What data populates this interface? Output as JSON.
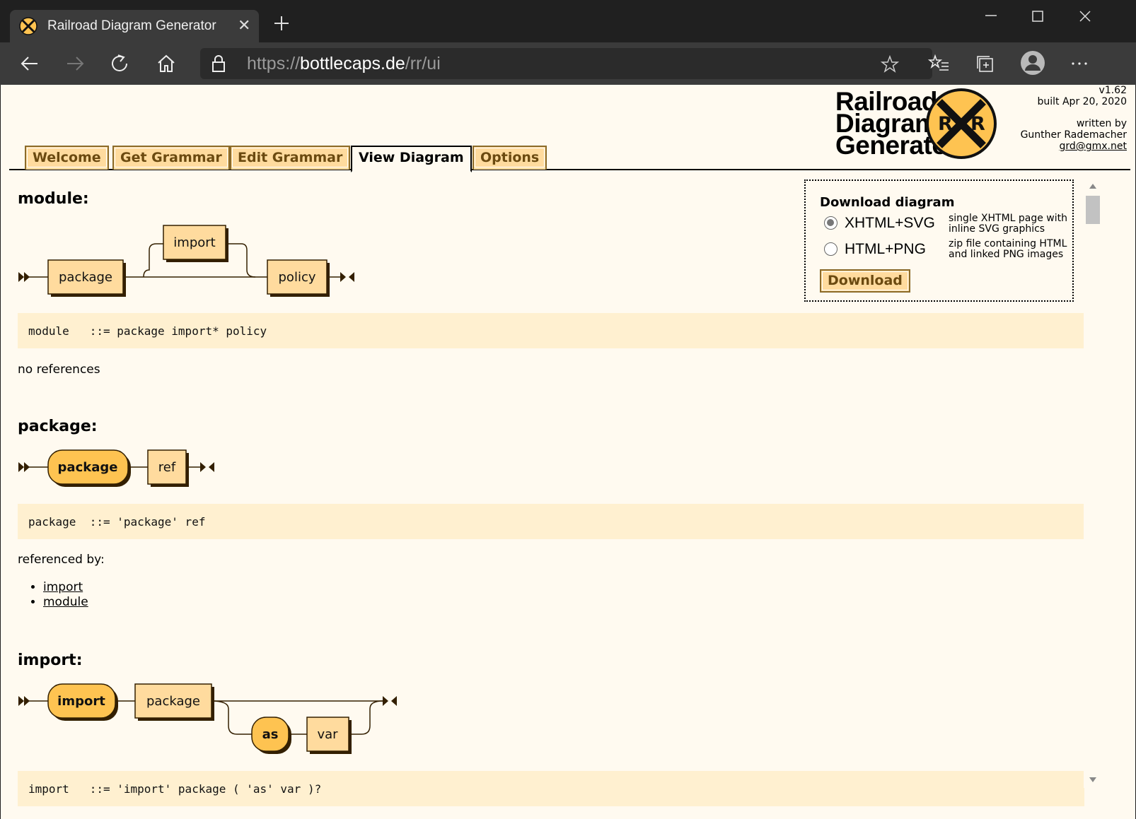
{
  "browser": {
    "tab_title": "Railroad Diagram Generator",
    "url_scheme": "https://",
    "url_host": "bottlecaps.de",
    "url_path": "/rr/ui"
  },
  "header": {
    "logo_line1": "Railroad",
    "logo_line2": "Diagram",
    "logo_line3": "Generator",
    "logo_sign_letter_left": "R",
    "logo_sign_letter_right": "R",
    "version": "v1.62",
    "built": "built Apr 20, 2020",
    "written_by": "written by",
    "author": "Gunther Rademacher",
    "email": "grd@gmx.net"
  },
  "tabs": [
    {
      "label": "Welcome"
    },
    {
      "label": "Get Grammar"
    },
    {
      "label": "Edit Grammar"
    },
    {
      "label": "View Diagram",
      "active": true
    },
    {
      "label": "Options"
    }
  ],
  "download": {
    "title": "Download diagram",
    "options": [
      {
        "label": "XHTML+SVG",
        "desc1": "single XHTML page with",
        "desc2": "inline SVG graphics",
        "selected": true
      },
      {
        "label": "HTML+PNG",
        "desc1": "zip file containing HTML",
        "desc2": "and linked PNG images",
        "selected": false
      }
    ],
    "button": "Download"
  },
  "rules": [
    {
      "name": "module:",
      "ebnf": "module   ::= package import* policy",
      "refs_label": "no references",
      "terms": [
        "package",
        "import",
        "policy"
      ],
      "references": []
    },
    {
      "name": "package:",
      "ebnf": "package  ::= 'package' ref",
      "refs_label": "referenced by:",
      "terms": [
        "package",
        "ref"
      ],
      "references": [
        "import",
        "module"
      ]
    },
    {
      "name": "import:",
      "ebnf": "import   ::= 'import' package ( 'as' var )?",
      "terms": [
        "import",
        "package",
        "as",
        "var"
      ]
    }
  ],
  "colors": {
    "page_bg": "#fffaf0",
    "box_fill": "#ffdb9e",
    "terminal_fill": "#fec351",
    "code_bg": "#fff0d0",
    "accent_text": "#6b4a10"
  }
}
